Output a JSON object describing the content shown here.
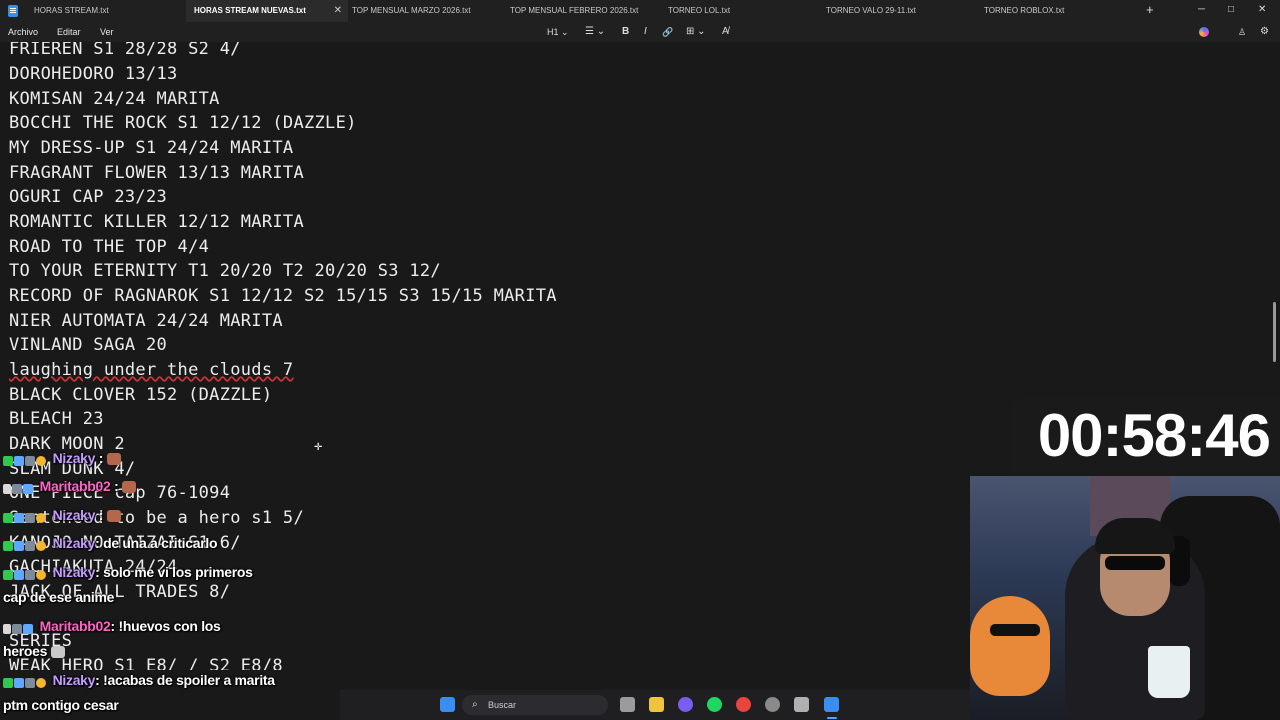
{
  "tabs": [
    {
      "label": "HORAS STREAM.txt",
      "active": false
    },
    {
      "label": "HORAS STREAM NUEVAS.txt",
      "active": true
    },
    {
      "label": "TOP MENSUAL MARZO 2026.txt",
      "active": false
    },
    {
      "label": "TOP MENSUAL FEBRERO 2026.txt",
      "active": false
    },
    {
      "label": "TORNEO LOL.txt",
      "active": false
    },
    {
      "label": "TORNEO VALO 29-11.txt",
      "active": false
    },
    {
      "label": "TORNEO ROBLOX.txt",
      "active": false
    }
  ],
  "add_tab": "+",
  "window_controls": {
    "minimize": "─",
    "maximize": "□",
    "close": "✕"
  },
  "menu": {
    "file": "Archivo",
    "edit": "Editar",
    "view": "Ver"
  },
  "toolbar": {
    "heading": "H1",
    "list": "☰",
    "bold": "B",
    "italic": "I",
    "link": "🔗",
    "table": "⊞",
    "clear": "A̸"
  },
  "editor_lines": [
    "FRIEREN S1 28/28 S2 4/",
    "DOROHEDORO 13/13",
    "KOMISAN 24/24 MARITA",
    "BOCCHI THE ROCK S1 12/12 (DAZZLE)",
    "MY DRESS-UP S1 24/24 MARITA",
    "FRAGRANT FLOWER 13/13 MARITA",
    "OGURI CAP 23/23",
    "ROMANTIC KILLER 12/12 MARITA",
    "ROAD TO THE TOP 4/4",
    "TO YOUR ETERNITY T1 20/20 T2 20/20 S3 12/",
    "RECORD OF RAGNAROK S1 12/12 S2 15/15 S3 15/15 MARITA",
    "NIER AUTOMATA 24/24 MARITA",
    "VINLAND SAGA 20",
    "laughing under the clouds 7",
    "BLACK CLOVER 152 (DAZZLE)",
    "BLEACH 23",
    "DARK MOON 2",
    "SLAM DUNK 4/",
    "ONE PIECE cap 76-1094",
    "Sentenced to be a hero s1 5/",
    "KANOJO NO TAIZAI S1 6/",
    "GACHIAKUTA 24/24",
    "JACK OF ALL TRADES 8/",
    "",
    "SERIES",
    "WEAK HERO S1 E8/ / S2 E8/8"
  ],
  "timer": "00:58:46",
  "chat": [
    {
      "user": "Nizaky",
      "text": "",
      "user_color": "purple"
    },
    {
      "user": "Maritabb02",
      "text": "",
      "user_color": "pink"
    },
    {
      "user": "Nizaky",
      "text": "",
      "user_color": "purple"
    },
    {
      "user": "Nizaky",
      "text": ": de una a criticarlo",
      "user_color": "purple"
    },
    {
      "user": "Nizaky",
      "text": ": solo me vi los primeros",
      "user_color": "purple"
    },
    {
      "continuation": "cap de ese anime"
    },
    {
      "user": "Maritabb02",
      "text": ": !huevos con los",
      "user_color": "pink"
    },
    {
      "continuation": "heroes"
    },
    {
      "user": "Nizaky",
      "text": ": !acabas de spoiler a marita",
      "user_color": "purple"
    },
    {
      "continuation": "ptm contigo cesar"
    }
  ],
  "taskbar": {
    "search_placeholder": "Buscar"
  }
}
